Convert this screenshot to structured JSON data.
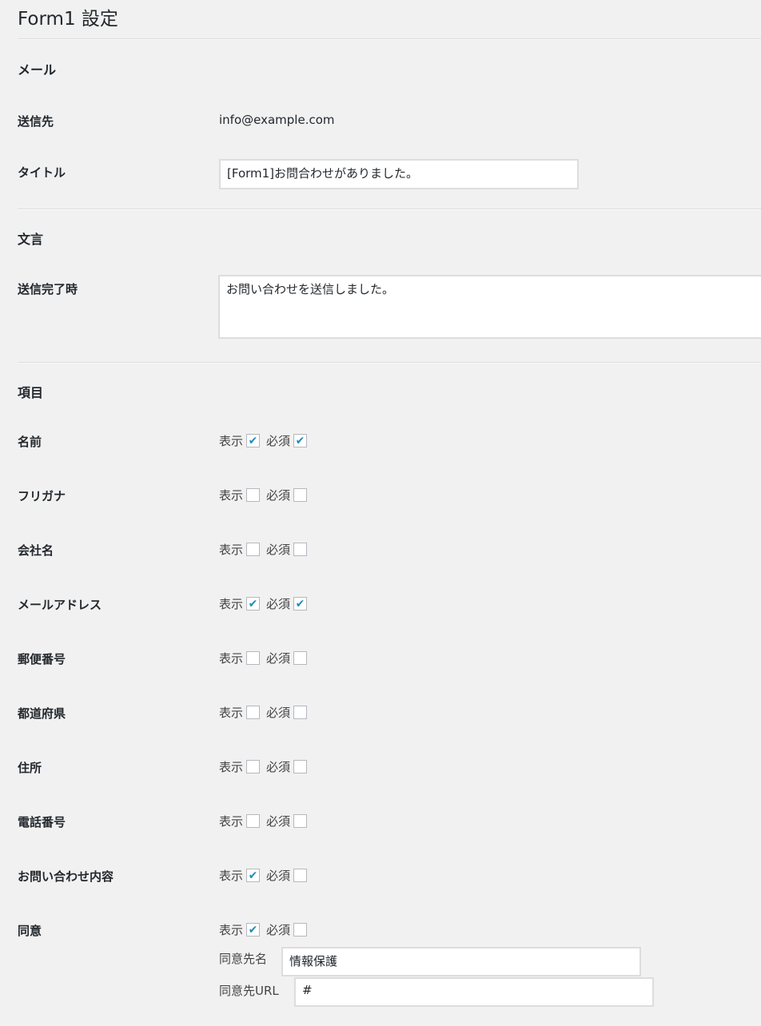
{
  "title": "Form1 設定",
  "mail": {
    "heading": "メール",
    "to_label": "送信先",
    "to_value": "info@example.com",
    "subject_label": "タイトル",
    "subject_value": "[Form1]お問合わせがありました。"
  },
  "text": {
    "heading": "文言",
    "complete_label": "送信完了時",
    "complete_value": "お問い合わせを送信しました。"
  },
  "fields": {
    "heading": "項目",
    "show_label": "表示",
    "required_label": "必須",
    "rows": [
      {
        "label": "名前",
        "show": true,
        "required": true
      },
      {
        "label": "フリガナ",
        "show": false,
        "required": false
      },
      {
        "label": "会社名",
        "show": false,
        "required": false
      },
      {
        "label": "メールアドレス",
        "show": true,
        "required": true
      },
      {
        "label": "郵便番号",
        "show": false,
        "required": false
      },
      {
        "label": "都道府県",
        "show": false,
        "required": false
      },
      {
        "label": "住所",
        "show": false,
        "required": false
      },
      {
        "label": "電話番号",
        "show": false,
        "required": false
      },
      {
        "label": "お問い合わせ内容",
        "show": true,
        "required": false
      },
      {
        "label": "同意",
        "show": true,
        "required": false
      }
    ],
    "consent_name_label": "同意先名",
    "consent_name_value": "情報保護",
    "consent_url_label": "同意先URL",
    "consent_url_value": "#"
  },
  "check_glyph": "✔"
}
